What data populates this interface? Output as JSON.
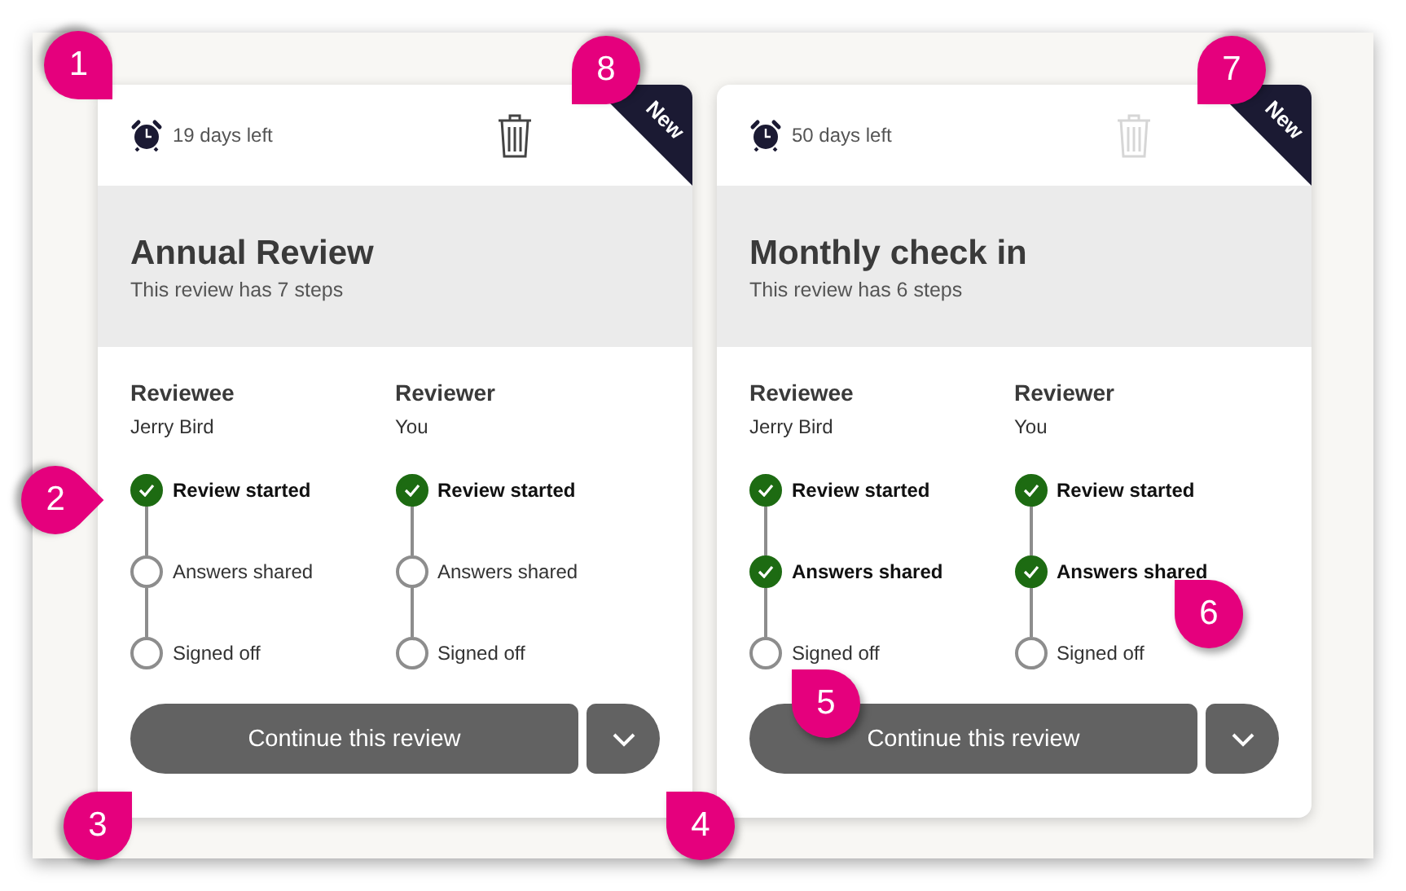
{
  "cards": [
    {
      "days_left": "19 days left",
      "delete_disabled": false,
      "badge": "New",
      "title": "Annual Review",
      "subtitle": "This review has 7 steps",
      "button": "Continue this review",
      "columns": [
        {
          "heading": "Reviewee",
          "name": "Jerry Bird",
          "steps": [
            {
              "label": "Review started",
              "done": true
            },
            {
              "label": "Answers shared",
              "done": false
            },
            {
              "label": "Signed off",
              "done": false
            }
          ]
        },
        {
          "heading": "Reviewer",
          "name": "You",
          "steps": [
            {
              "label": "Review started",
              "done": true
            },
            {
              "label": "Answers shared",
              "done": false
            },
            {
              "label": "Signed off",
              "done": false
            }
          ]
        }
      ]
    },
    {
      "days_left": "50 days left",
      "delete_disabled": true,
      "badge": "New",
      "title": "Monthly check in",
      "subtitle": "This review has 6 steps",
      "button": "Continue this review",
      "columns": [
        {
          "heading": "Reviewee",
          "name": "Jerry Bird",
          "steps": [
            {
              "label": "Review started",
              "done": true
            },
            {
              "label": "Answers shared",
              "done": true
            },
            {
              "label": "Signed off",
              "done": false
            }
          ]
        },
        {
          "heading": "Reviewer",
          "name": "You",
          "steps": [
            {
              "label": "Review started",
              "done": true
            },
            {
              "label": "Answers shared",
              "done": true
            },
            {
              "label": "Signed off",
              "done": false
            }
          ]
        }
      ]
    }
  ],
  "callouts": [
    {
      "label": "1"
    },
    {
      "label": "8"
    },
    {
      "label": "7"
    },
    {
      "label": "2"
    },
    {
      "label": "6"
    },
    {
      "label": "5"
    },
    {
      "label": "3"
    },
    {
      "label": "4"
    }
  ]
}
